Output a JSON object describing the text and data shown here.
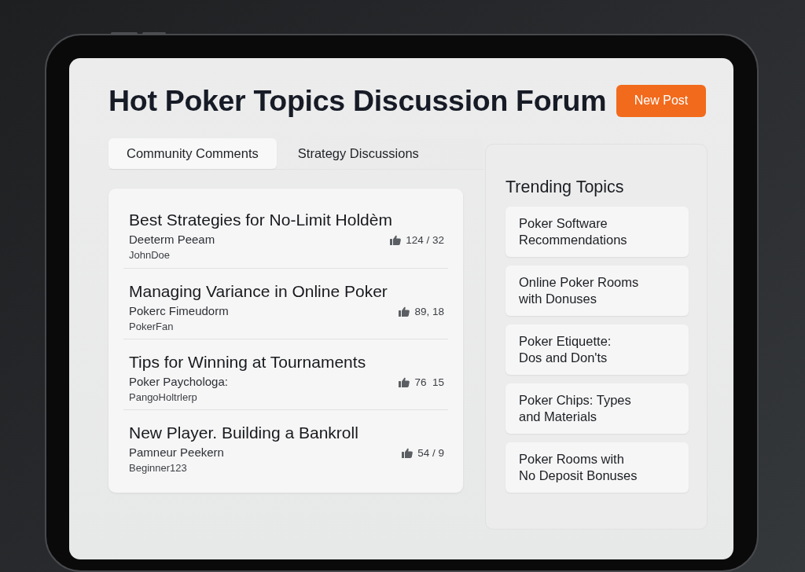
{
  "header": {
    "title": "Hot Poker Topics Discussion Forum",
    "new_post_button": "New Post"
  },
  "tabs": [
    {
      "label": "Community Comments",
      "selected": true
    },
    {
      "label": "Strategy Discussions",
      "selected": false
    }
  ],
  "posts": [
    {
      "title": "Best Strategies for No-Limit Holdèm",
      "subtitle": "Deeterm Peeam",
      "author": "JohnDoe",
      "stats": "124 / 32"
    },
    {
      "title": "Managing Variance in Online Poker",
      "subtitle": "Pokerc Fimeudorm",
      "author": "PokerFan",
      "stats": "89, 18"
    },
    {
      "title": "Tips for Winning at Tournaments",
      "subtitle": "Poker Paychologa:",
      "author": "PangoHoltrlerp",
      "stats": "76  15"
    },
    {
      "title": "New Player. Building a Bankroll",
      "subtitle": "Pamneur Peekern",
      "author": "Beginner123",
      "stats": "54 / 9"
    }
  ],
  "trending": {
    "title": "Trending Topics",
    "topics": [
      {
        "lines": [
          "Poker Software",
          "Recommendations"
        ]
      },
      {
        "lines": [
          "Online Poker Rooms",
          "with Donuses"
        ]
      },
      {
        "lines": [
          "Poker Etiquette:",
          "Dos and Don'ts"
        ]
      },
      {
        "lines": [
          "Poker Chips: Types",
          "and Materials"
        ]
      },
      {
        "lines": [
          "Poker Rooms with",
          "No Deposit Bonuses"
        ]
      }
    ]
  }
}
